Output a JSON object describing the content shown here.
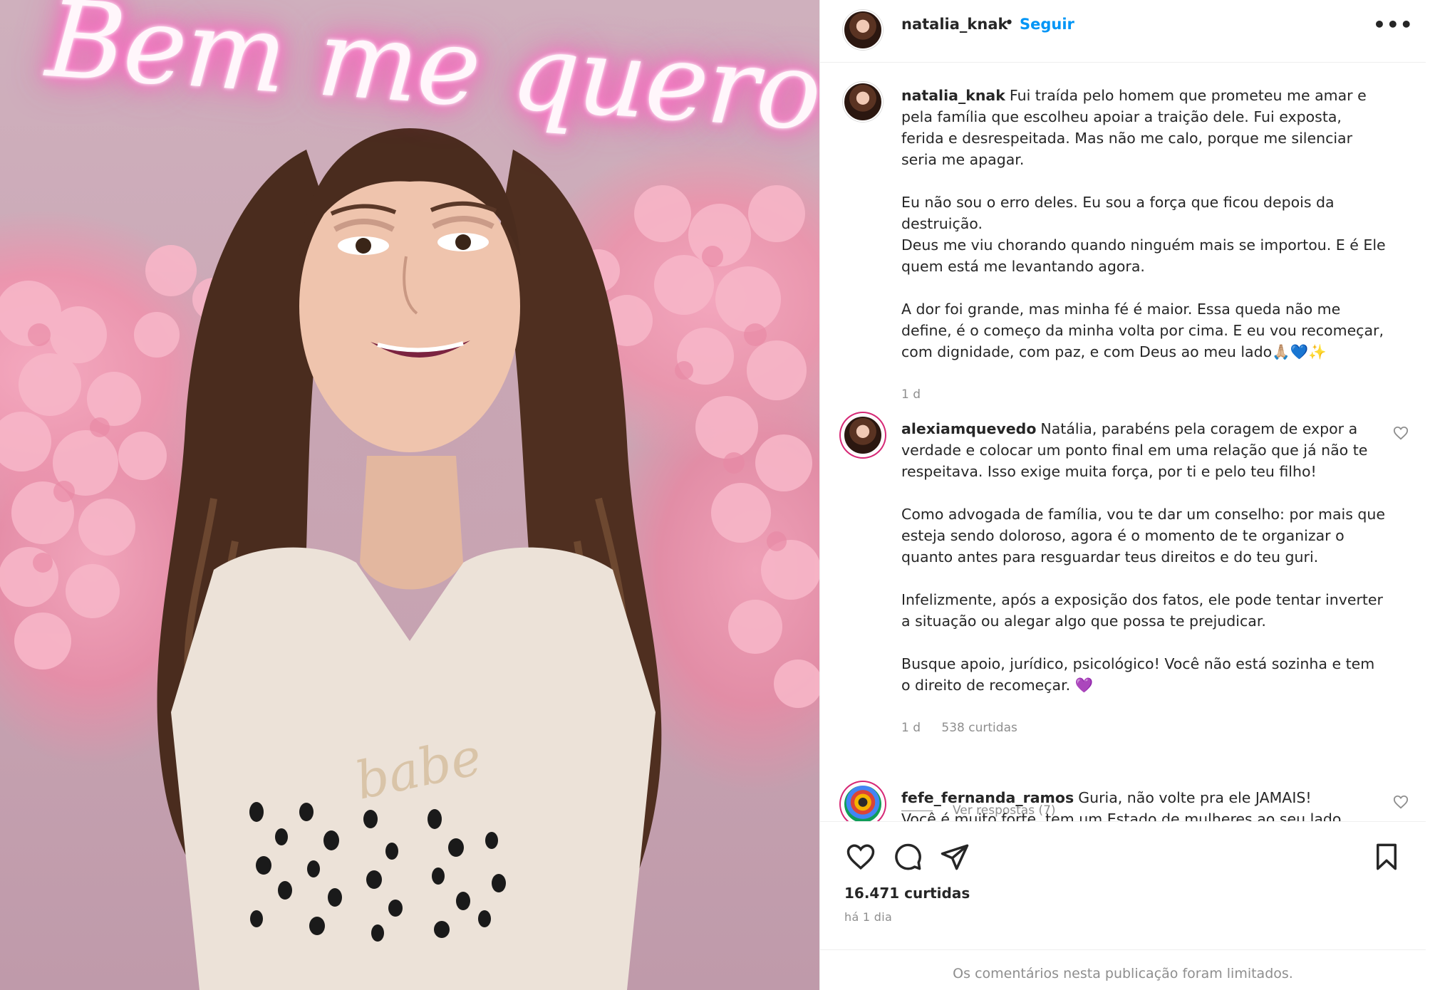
{
  "photo": {
    "neon_sign_text": "Bem me quero",
    "shirt_text": "babe"
  },
  "post": {
    "username": "natalia_knak",
    "separator": "•",
    "follow_label": "Seguir",
    "more_icon": "more-horizontal-icon",
    "caption": {
      "author": "natalia_knak",
      "paragraphs": [
        "Fui traída pelo homem que prometeu me amar e pela família que escolheu apoiar a traição dele. Fui exposta, ferida e desrespeitada. Mas não me calo, porque me silenciar seria me apagar.",
        "Eu não sou o erro deles. Eu sou a força que ficou depois da destruição.\nDeus me viu chorando quando ninguém mais se importou. E é Ele quem está me levantando agora.",
        "A dor foi grande, mas minha fé é maior. Essa queda não me define, é o começo da minha volta por cima. E eu vou recomeçar, com dignidade, com paz, e com Deus ao meu lado🙏🏼💙✨"
      ],
      "time": "1 d"
    },
    "comments": [
      {
        "author": "alexiamquevedo",
        "paragraphs": [
          "Natália, parabéns pela coragem de expor a verdade e colocar um ponto final em uma relação que já não te respeitava. Isso exige muita força, por ti e pelo teu filho!",
          "Como advogada de família, vou te dar um conselho: por mais que esteja sendo doloroso, agora é o momento de te organizar o quanto antes para resguardar teus direitos e do teu guri.",
          "Infelizmente, após a exposição dos fatos, ele pode tentar inverter a situação ou alegar algo que possa te prejudicar.",
          "Busque apoio, jurídico, psicológico! Você não está sozinha e tem o direito de recomeçar. 💜"
        ],
        "time": "1 d",
        "likes": "538 curtidas",
        "replies": "Ver respostas (7)"
      },
      {
        "author": "fefe_fernanda_ramos",
        "paragraphs": [
          "Guria, não volte pra ele JAMAIS!\nVocê é muito forte, tem um Estado de mulheres ao seu lado"
        ]
      }
    ],
    "likes": "16.471 curtidas",
    "date": "há 1 dia",
    "comments_limited": "Os comentários nesta publicação foram limitados."
  },
  "icons": {
    "like": "heart-icon",
    "comment": "comment-icon",
    "share": "send-icon",
    "save": "bookmark-icon"
  }
}
